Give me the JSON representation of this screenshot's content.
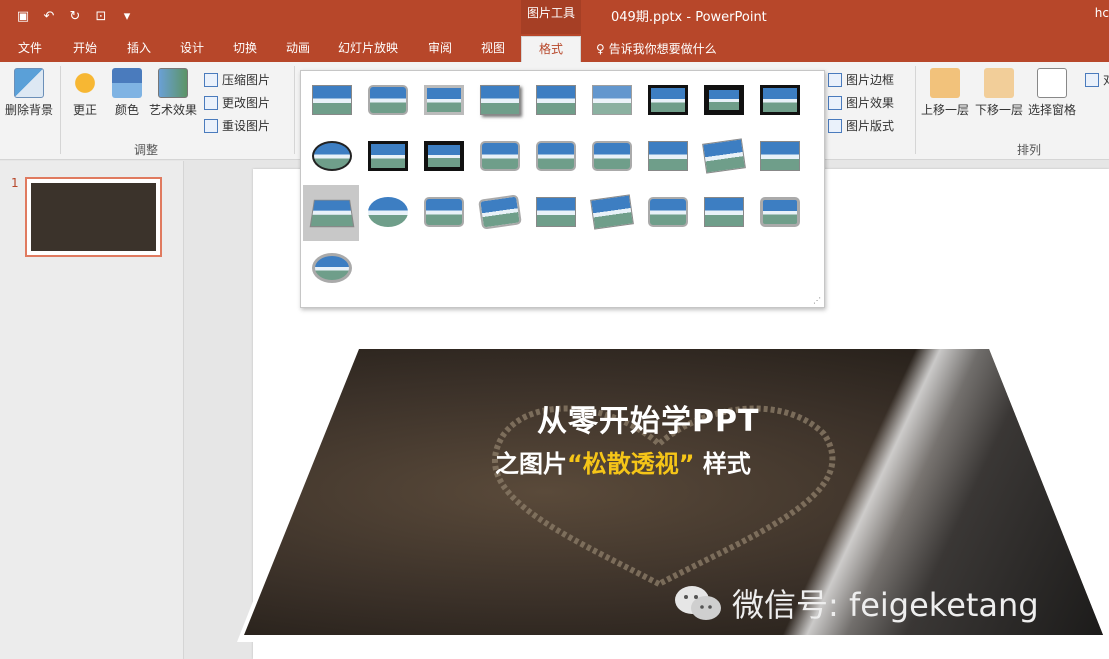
{
  "window": {
    "context_tools_label": "图片工具",
    "doc_title": "049期.pptx - PowerPoint",
    "user_name": "hc"
  },
  "qat": [
    "save",
    "undo",
    "redo",
    "present",
    "customize"
  ],
  "tabs": [
    {
      "label": "文件",
      "active": false
    },
    {
      "label": "开始",
      "active": false
    },
    {
      "label": "插入",
      "active": false
    },
    {
      "label": "设计",
      "active": false
    },
    {
      "label": "切换",
      "active": false
    },
    {
      "label": "动画",
      "active": false
    },
    {
      "label": "幻灯片放映",
      "active": false
    },
    {
      "label": "审阅",
      "active": false
    },
    {
      "label": "视图",
      "active": false
    },
    {
      "label": "格式",
      "active": true
    }
  ],
  "tell_me": "告诉我你想要做什么",
  "ribbon": {
    "remove_bg": "删除背景",
    "corrections": "更正",
    "color": "颜色",
    "artistic": "艺术效果",
    "compress": "压缩图片",
    "change": "更改图片",
    "reset": "重设图片",
    "adjust_group": "调整",
    "border": "图片边框",
    "effects": "图片效果",
    "layout": "图片版式",
    "forward": "上移一层",
    "backward": "下移一层",
    "selection": "选择窗格",
    "arrange_group": "排列",
    "align": "对"
  },
  "slide_panel": {
    "slide_number": "1"
  },
  "slide": {
    "title": "从零开始学PPT",
    "subtitle_before": "之图片",
    "subtitle_highlight": "“松散透视”",
    "subtitle_after": "样式",
    "watermark": "微信号: feigeketang"
  },
  "colors": {
    "accent": "#b7472a",
    "highlight": "#f5c518"
  }
}
